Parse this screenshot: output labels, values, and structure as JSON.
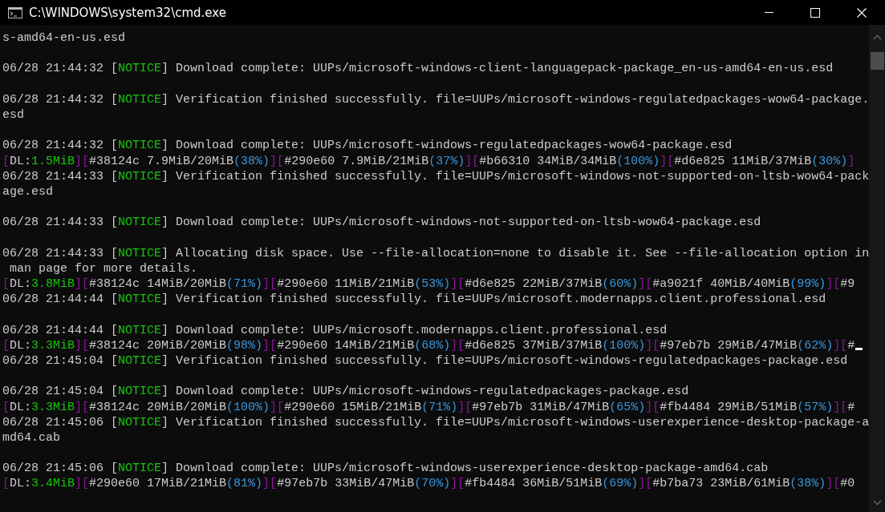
{
  "window": {
    "title": "C:\\WINDOWS\\system32\\cmd.exe"
  },
  "lines": [
    {
      "kind": "text",
      "segments": [
        {
          "kind": "plain",
          "text": "s-amd64-en-us.esd"
        }
      ]
    },
    {
      "kind": "blank"
    },
    {
      "kind": "text",
      "segments": [
        {
          "kind": "plain",
          "text": "06/28 21:44:32 ["
        },
        {
          "kind": "notice",
          "text": "NOTICE"
        },
        {
          "kind": "plain",
          "text": "] Download complete: UUPs/microsoft-windows-client-languagepack-package_en-us-amd64-en-us.esd"
        }
      ]
    },
    {
      "kind": "blank"
    },
    {
      "kind": "text",
      "segments": [
        {
          "kind": "plain",
          "text": "06/28 21:44:32 ["
        },
        {
          "kind": "notice",
          "text": "NOTICE"
        },
        {
          "kind": "plain",
          "text": "] Verification finished successfully. file=UUPs/microsoft-windows-regulatedpackages-wow64-package."
        }
      ]
    },
    {
      "kind": "text",
      "segments": [
        {
          "kind": "plain",
          "text": "esd"
        }
      ]
    },
    {
      "kind": "blank"
    },
    {
      "kind": "text",
      "segments": [
        {
          "kind": "plain",
          "text": "06/28 21:44:32 ["
        },
        {
          "kind": "notice",
          "text": "NOTICE"
        },
        {
          "kind": "plain",
          "text": "] Download complete: UUPs/microsoft-windows-regulatedpackages-wow64-package.esd"
        }
      ]
    },
    {
      "kind": "text",
      "segments": [
        {
          "kind": "bracket",
          "text": "["
        },
        {
          "kind": "plain",
          "text": "DL:"
        },
        {
          "kind": "speed",
          "text": "1.5MiB"
        },
        {
          "kind": "bracket",
          "text": "]["
        },
        {
          "kind": "plain",
          "text": "#38124c 7.9MiB/20MiB"
        },
        {
          "kind": "percent",
          "text": "(38%)"
        },
        {
          "kind": "bracket",
          "text": "]["
        },
        {
          "kind": "plain",
          "text": "#290e60 7.9MiB/21MiB"
        },
        {
          "kind": "percent",
          "text": "(37%)"
        },
        {
          "kind": "bracket",
          "text": "]["
        },
        {
          "kind": "plain",
          "text": "#b66310 34MiB/34MiB"
        },
        {
          "kind": "percent",
          "text": "(100%)"
        },
        {
          "kind": "bracket",
          "text": "]["
        },
        {
          "kind": "plain",
          "text": "#d6e825 11MiB/37MiB"
        },
        {
          "kind": "percent",
          "text": "(30%)"
        },
        {
          "kind": "bracket",
          "text": "]"
        }
      ]
    },
    {
      "kind": "text",
      "segments": [
        {
          "kind": "plain",
          "text": "06/28 21:44:33 ["
        },
        {
          "kind": "notice",
          "text": "NOTICE"
        },
        {
          "kind": "plain",
          "text": "] Verification finished successfully. file=UUPs/microsoft-windows-not-supported-on-ltsb-wow64-pack"
        }
      ]
    },
    {
      "kind": "text",
      "segments": [
        {
          "kind": "plain",
          "text": "age.esd"
        }
      ]
    },
    {
      "kind": "blank"
    },
    {
      "kind": "text",
      "segments": [
        {
          "kind": "plain",
          "text": "06/28 21:44:33 ["
        },
        {
          "kind": "notice",
          "text": "NOTICE"
        },
        {
          "kind": "plain",
          "text": "] Download complete: UUPs/microsoft-windows-not-supported-on-ltsb-wow64-package.esd"
        }
      ]
    },
    {
      "kind": "blank"
    },
    {
      "kind": "text",
      "segments": [
        {
          "kind": "plain",
          "text": "06/28 21:44:33 ["
        },
        {
          "kind": "notice",
          "text": "NOTICE"
        },
        {
          "kind": "plain",
          "text": "] Allocating disk space. Use --file-allocation=none to disable it. See --file-allocation option in"
        }
      ]
    },
    {
      "kind": "text",
      "segments": [
        {
          "kind": "plain",
          "text": " man page for more details."
        }
      ]
    },
    {
      "kind": "text",
      "segments": [
        {
          "kind": "bracket",
          "text": "["
        },
        {
          "kind": "plain",
          "text": "DL:"
        },
        {
          "kind": "speed",
          "text": "3.8MiB"
        },
        {
          "kind": "bracket",
          "text": "]["
        },
        {
          "kind": "plain",
          "text": "#38124c 14MiB/20MiB"
        },
        {
          "kind": "percent",
          "text": "(71%)"
        },
        {
          "kind": "bracket",
          "text": "]["
        },
        {
          "kind": "plain",
          "text": "#290e60 11MiB/21MiB"
        },
        {
          "kind": "percent",
          "text": "(53%)"
        },
        {
          "kind": "bracket",
          "text": "]["
        },
        {
          "kind": "plain",
          "text": "#d6e825 22MiB/37MiB"
        },
        {
          "kind": "percent",
          "text": "(60%)"
        },
        {
          "kind": "bracket",
          "text": "]["
        },
        {
          "kind": "plain",
          "text": "#a9021f 40MiB/40MiB"
        },
        {
          "kind": "percent",
          "text": "(99%)"
        },
        {
          "kind": "bracket",
          "text": "]["
        },
        {
          "kind": "plain",
          "text": "#9"
        }
      ]
    },
    {
      "kind": "text",
      "segments": [
        {
          "kind": "plain",
          "text": "06/28 21:44:44 ["
        },
        {
          "kind": "notice",
          "text": "NOTICE"
        },
        {
          "kind": "plain",
          "text": "] Verification finished successfully. file=UUPs/microsoft.modernapps.client.professional.esd"
        }
      ]
    },
    {
      "kind": "blank"
    },
    {
      "kind": "text",
      "segments": [
        {
          "kind": "plain",
          "text": "06/28 21:44:44 ["
        },
        {
          "kind": "notice",
          "text": "NOTICE"
        },
        {
          "kind": "plain",
          "text": "] Download complete: UUPs/microsoft.modernapps.client.professional.esd"
        }
      ]
    },
    {
      "kind": "text",
      "cursor": true,
      "segments": [
        {
          "kind": "bracket",
          "text": "["
        },
        {
          "kind": "plain",
          "text": "DL:"
        },
        {
          "kind": "speed",
          "text": "3.3MiB"
        },
        {
          "kind": "bracket",
          "text": "]["
        },
        {
          "kind": "plain",
          "text": "#38124c 20MiB/20MiB"
        },
        {
          "kind": "percent",
          "text": "(98%)"
        },
        {
          "kind": "bracket",
          "text": "]["
        },
        {
          "kind": "plain",
          "text": "#290e60 14MiB/21MiB"
        },
        {
          "kind": "percent",
          "text": "(68%)"
        },
        {
          "kind": "bracket",
          "text": "]["
        },
        {
          "kind": "plain",
          "text": "#d6e825 37MiB/37MiB"
        },
        {
          "kind": "percent",
          "text": "(100%)"
        },
        {
          "kind": "bracket",
          "text": "]["
        },
        {
          "kind": "plain",
          "text": "#97eb7b 29MiB/47MiB"
        },
        {
          "kind": "percent",
          "text": "(62%)"
        },
        {
          "kind": "bracket",
          "text": "]["
        },
        {
          "kind": "plain",
          "text": "#"
        }
      ]
    },
    {
      "kind": "text",
      "segments": [
        {
          "kind": "plain",
          "text": "06/28 21:45:04 ["
        },
        {
          "kind": "notice",
          "text": "NOTICE"
        },
        {
          "kind": "plain",
          "text": "] Verification finished successfully. file=UUPs/microsoft-windows-regulatedpackages-package.esd"
        }
      ]
    },
    {
      "kind": "blank"
    },
    {
      "kind": "text",
      "segments": [
        {
          "kind": "plain",
          "text": "06/28 21:45:04 ["
        },
        {
          "kind": "notice",
          "text": "NOTICE"
        },
        {
          "kind": "plain",
          "text": "] Download complete: UUPs/microsoft-windows-regulatedpackages-package.esd"
        }
      ]
    },
    {
      "kind": "text",
      "segments": [
        {
          "kind": "bracket",
          "text": "["
        },
        {
          "kind": "plain",
          "text": "DL:"
        },
        {
          "kind": "speed",
          "text": "3.3MiB"
        },
        {
          "kind": "bracket",
          "text": "]["
        },
        {
          "kind": "plain",
          "text": "#38124c 20MiB/20MiB"
        },
        {
          "kind": "percent",
          "text": "(100%)"
        },
        {
          "kind": "bracket",
          "text": "]["
        },
        {
          "kind": "plain",
          "text": "#290e60 15MiB/21MiB"
        },
        {
          "kind": "percent",
          "text": "(71%)"
        },
        {
          "kind": "bracket",
          "text": "]["
        },
        {
          "kind": "plain",
          "text": "#97eb7b 31MiB/47MiB"
        },
        {
          "kind": "percent",
          "text": "(65%)"
        },
        {
          "kind": "bracket",
          "text": "]["
        },
        {
          "kind": "plain",
          "text": "#fb4484 29MiB/51MiB"
        },
        {
          "kind": "percent",
          "text": "(57%)"
        },
        {
          "kind": "bracket",
          "text": "]["
        },
        {
          "kind": "plain",
          "text": "#"
        }
      ]
    },
    {
      "kind": "text",
      "segments": [
        {
          "kind": "plain",
          "text": "06/28 21:45:06 ["
        },
        {
          "kind": "notice",
          "text": "NOTICE"
        },
        {
          "kind": "plain",
          "text": "] Verification finished successfully. file=UUPs/microsoft-windows-userexperience-desktop-package-a"
        }
      ]
    },
    {
      "kind": "text",
      "segments": [
        {
          "kind": "plain",
          "text": "md64.cab"
        }
      ]
    },
    {
      "kind": "blank"
    },
    {
      "kind": "text",
      "segments": [
        {
          "kind": "plain",
          "text": "06/28 21:45:06 ["
        },
        {
          "kind": "notice",
          "text": "NOTICE"
        },
        {
          "kind": "plain",
          "text": "] Download complete: UUPs/microsoft-windows-userexperience-desktop-package-amd64.cab"
        }
      ]
    },
    {
      "kind": "text",
      "segments": [
        {
          "kind": "bracket",
          "text": "["
        },
        {
          "kind": "plain",
          "text": "DL:"
        },
        {
          "kind": "speed",
          "text": "3.4MiB"
        },
        {
          "kind": "bracket",
          "text": "]["
        },
        {
          "kind": "plain",
          "text": "#290e60 17MiB/21MiB"
        },
        {
          "kind": "percent",
          "text": "(81%)"
        },
        {
          "kind": "bracket",
          "text": "]["
        },
        {
          "kind": "plain",
          "text": "#97eb7b 33MiB/47MiB"
        },
        {
          "kind": "percent",
          "text": "(70%)"
        },
        {
          "kind": "bracket",
          "text": "]["
        },
        {
          "kind": "plain",
          "text": "#fb4484 36MiB/51MiB"
        },
        {
          "kind": "percent",
          "text": "(69%)"
        },
        {
          "kind": "bracket",
          "text": "]["
        },
        {
          "kind": "plain",
          "text": "#b7ba73 23MiB/61MiB"
        },
        {
          "kind": "percent",
          "text": "(38%)"
        },
        {
          "kind": "bracket",
          "text": "]["
        },
        {
          "kind": "plain",
          "text": "#0"
        }
      ]
    }
  ]
}
